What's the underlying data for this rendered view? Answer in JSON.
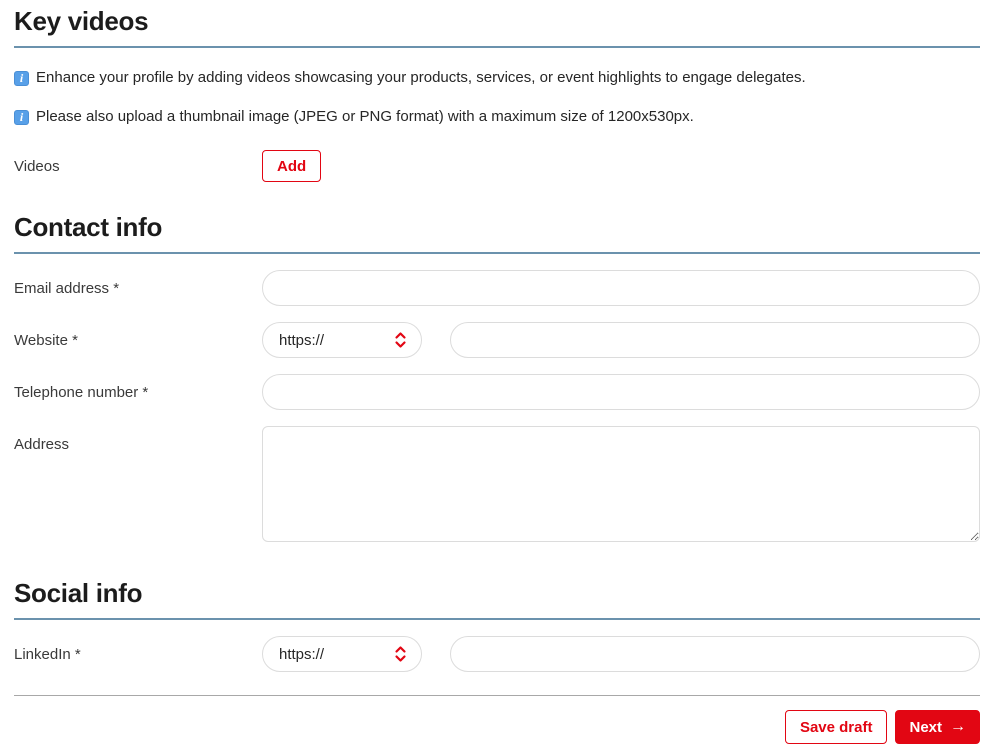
{
  "colors": {
    "accent_red": "#e20613",
    "heading_underline_blue": "#6b92ad",
    "info_icon_blue": "#58a0e8",
    "field_border": "#dcdcdc"
  },
  "icons": {
    "info_glyph": "i",
    "chevron_updown": "chevron-up-down",
    "arrow_right": "→"
  },
  "sections": {
    "key_videos": {
      "title": "Key videos",
      "info_notes": [
        "Enhance your profile by adding videos showcasing your products, services, or event highlights to engage delegates.",
        "Please also upload a thumbnail image (JPEG or PNG format) with a maximum size of 1200x530px."
      ],
      "videos_label": "Videos",
      "add_button_label": "Add"
    },
    "contact_info": {
      "title": "Contact info",
      "fields": [
        {
          "label": "Email address *",
          "type": "text",
          "value": "",
          "placeholder": ""
        },
        {
          "label": "Website *",
          "type": "url",
          "scheme_selected": "https://",
          "value": "",
          "placeholder": ""
        },
        {
          "label": "Telephone number *",
          "type": "text",
          "value": "",
          "placeholder": ""
        },
        {
          "label": "Address",
          "type": "textarea",
          "value": "",
          "placeholder": ""
        }
      ]
    },
    "social_info": {
      "title": "Social info",
      "fields": [
        {
          "label": "LinkedIn *",
          "type": "url",
          "scheme_selected": "https://",
          "value": "",
          "placeholder": ""
        }
      ]
    }
  },
  "footer": {
    "save_draft_label": "Save draft",
    "next_label": "Next",
    "next_arrow": "→"
  }
}
